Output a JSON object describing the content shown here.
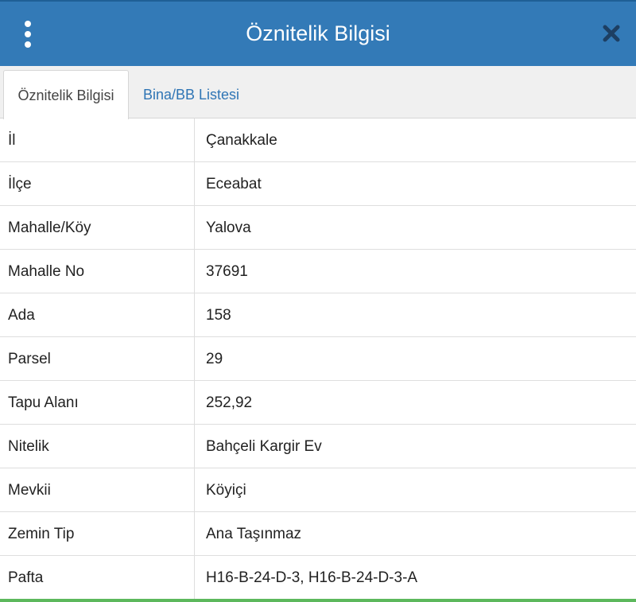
{
  "header": {
    "title": "Öznitelik Bilgisi",
    "menu_icon": "kebab-menu-icon",
    "close_icon": "close-icon"
  },
  "tabs": [
    {
      "label": "Öznitelik Bilgisi",
      "active": true
    },
    {
      "label": "Bina/BB Listesi",
      "active": false
    }
  ],
  "attributes": [
    {
      "label": "İl",
      "value": "Çanakkale"
    },
    {
      "label": "İlçe",
      "value": "Eceabat"
    },
    {
      "label": "Mahalle/Köy",
      "value": "Yalova"
    },
    {
      "label": "Mahalle No",
      "value": "37691"
    },
    {
      "label": "Ada",
      "value": "158"
    },
    {
      "label": "Parsel",
      "value": "29"
    },
    {
      "label": "Tapu Alanı",
      "value": "252,92"
    },
    {
      "label": "Nitelik",
      "value": "Bahçeli Kargir Ev"
    },
    {
      "label": "Mevkii",
      "value": "Köyiçi"
    },
    {
      "label": "Zemin Tip",
      "value": "Ana Taşınmaz"
    },
    {
      "label": "Pafta",
      "value": "H16-B-24-D-3, H16-B-24-D-3-A"
    }
  ],
  "colors": {
    "header_bg": "#337ab7",
    "tab_link": "#2f75b5",
    "accent_bottom": "#5cb85c"
  }
}
